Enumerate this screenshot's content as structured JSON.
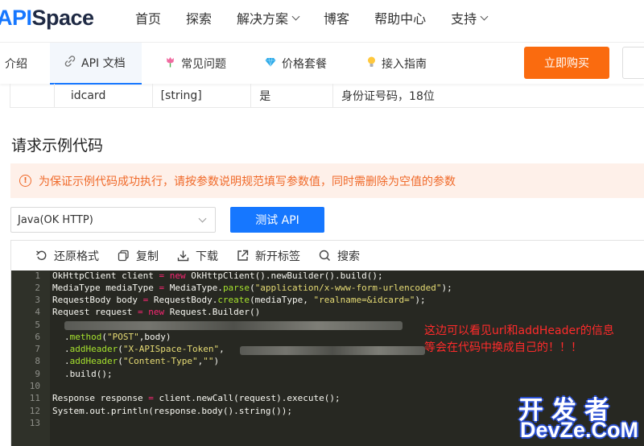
{
  "brand": {
    "logo_part_a": "API",
    "logo_part_b": "Space"
  },
  "nav": {
    "items": [
      {
        "label": "首页"
      },
      {
        "label": "探索"
      },
      {
        "label": "解决方案"
      },
      {
        "label": "博客"
      },
      {
        "label": "帮助中心"
      },
      {
        "label": "支持"
      }
    ]
  },
  "tabs": [
    {
      "label": "介绍"
    },
    {
      "label": "API 文档"
    },
    {
      "label": "常见问题"
    },
    {
      "label": "价格套餐"
    },
    {
      "label": "接入指南"
    }
  ],
  "buy_button": "立即购买",
  "param_row": {
    "name": "idcard",
    "type": "[string]",
    "required": "是",
    "desc": "身份证号码，18位"
  },
  "section_title": "请求示例代码",
  "alert": "为保证示例代码成功执行，请按参数说明规范填写参数值，同时需删除为空值的参数",
  "language_select": "Java(OK HTTP)",
  "test_button": "测试 API",
  "code_toolbar": {
    "format": "还原格式",
    "copy": "复制",
    "download": "下载",
    "new_tab": "新开标签",
    "search": "搜索"
  },
  "code_lines": [
    {
      "n": "1",
      "text": "OkHttpClient client = new OkHttpClient().newBuilder().build();"
    },
    {
      "n": "2",
      "text": "MediaType mediaType = MediaType.parse(\"application/x-www-form-urlencoded\");"
    },
    {
      "n": "3",
      "text": "RequestBody body = RequestBody.create(mediaType, \"realname=&idcard=\");"
    },
    {
      "n": "4",
      "text": "Request request = new Request.Builder()"
    },
    {
      "n": "5",
      "text": ""
    },
    {
      "n": "6",
      "text": ".method(\"POST\",body)"
    },
    {
      "n": "7",
      "text": ".addHeader(\"X-APISpace-Token\","
    },
    {
      "n": "8",
      "text": ".addHeader(\"Content-Type\",\"\")"
    },
    {
      "n": "9",
      "text": ".build();"
    },
    {
      "n": "10",
      "text": ""
    },
    {
      "n": "11",
      "text": "Response response = client.newCall(request).execute();"
    },
    {
      "n": "12",
      "text": "System.out.println(response.body().string());"
    },
    {
      "n": "13",
      "text": ""
    }
  ],
  "annotation": {
    "line1": "这边可以看见url和addHeader的信息",
    "line2": "等会在代码中换成自己的！！！"
  },
  "watermark": {
    "line1": "开发者",
    "line2": "DevZe.CoM"
  },
  "colors": {
    "accent_blue": "#1677ff",
    "buy_orange": "#fa6b0f",
    "alert_orange": "#f06a2a",
    "code_bg": "#272822",
    "annotation_red": "#ff2b2b"
  }
}
